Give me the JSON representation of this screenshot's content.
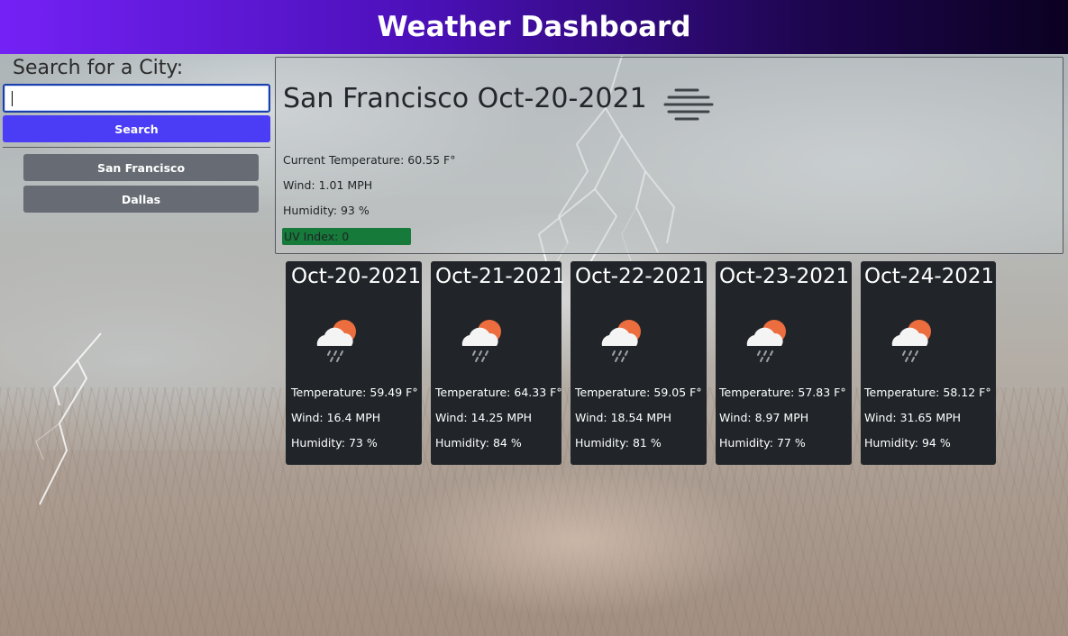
{
  "header": {
    "title": "Weather Dashboard"
  },
  "sidebar": {
    "heading": "Search for a City:",
    "search": {
      "value": "",
      "placeholder": ""
    },
    "search_button": "Search",
    "history": [
      {
        "label": "San Francisco"
      },
      {
        "label": "Dallas"
      }
    ]
  },
  "current": {
    "city_date": "San Francisco Oct-20-2021",
    "icon": "mist-icon",
    "temperature": "Current Temperature: 60.55 F°",
    "wind": "Wind: 1.01 MPH",
    "humidity": "Humidity: 93 %",
    "uv": "UV Index: 0",
    "uv_color": "#157a3a"
  },
  "forecast": [
    {
      "date": "Oct-20-2021",
      "icon": "sun-cloud-rain-icon",
      "temp": "Temperature: 59.49 F°",
      "wind": "Wind: 16.4 MPH",
      "humidity": "Humidity: 73 %"
    },
    {
      "date": "Oct-21-2021",
      "icon": "sun-cloud-rain-icon",
      "temp": "Temperature: 64.33 F°",
      "wind": "Wind: 14.25 MPH",
      "humidity": "Humidity: 84 %"
    },
    {
      "date": "Oct-22-2021",
      "icon": "sun-cloud-rain-icon",
      "temp": "Temperature: 59.05 F°",
      "wind": "Wind: 18.54 MPH",
      "humidity": "Humidity: 81 %"
    },
    {
      "date": "Oct-23-2021",
      "icon": "sun-cloud-rain-icon",
      "temp": "Temperature: 57.83 F°",
      "wind": "Wind: 8.97 MPH",
      "humidity": "Humidity: 77 %"
    },
    {
      "date": "Oct-24-2021",
      "icon": "sun-cloud-rain-icon",
      "temp": "Temperature: 58.12 F°",
      "wind": "Wind: 31.65 MPH",
      "humidity": "Humidity: 94 %"
    }
  ],
  "colors": {
    "header_gradient_start": "#7421f5",
    "header_gradient_end": "#0b0122",
    "search_button": "#4a3df5",
    "history_button": "#676c74",
    "forecast_card": "#212529"
  }
}
